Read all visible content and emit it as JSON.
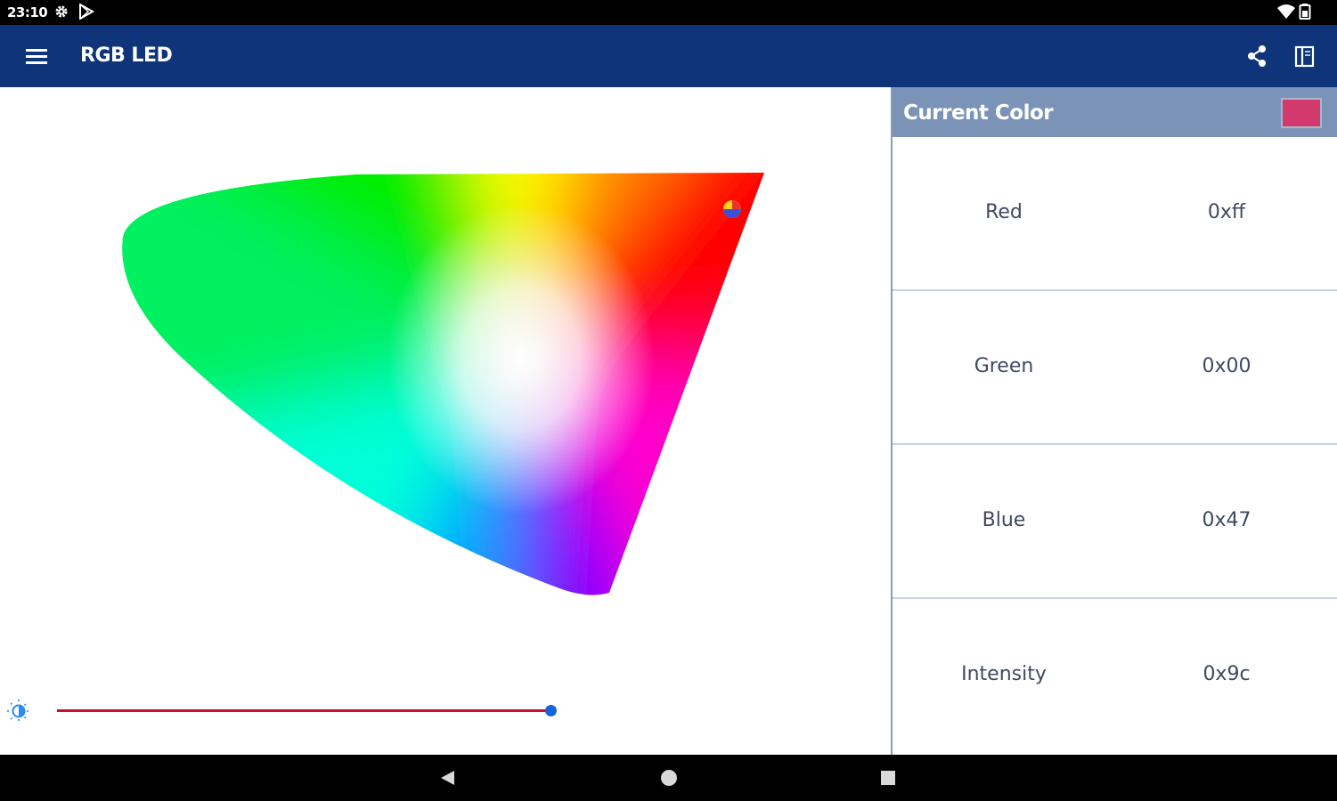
{
  "status_bar": {
    "time": "23:10",
    "icons": [
      "gear-icon",
      "play-store-icon",
      "wifi-icon",
      "battery-icon"
    ]
  },
  "app_bar": {
    "title": "RGB LED",
    "icons": [
      "menu-icon",
      "share-icon",
      "book-icon"
    ],
    "color": "#0f3479"
  },
  "current_color": {
    "title": "Current Color",
    "swatch_color": "#d23a6e",
    "rows": [
      {
        "label": "Red",
        "value": "0xff"
      },
      {
        "label": "Green",
        "value": "0x00"
      },
      {
        "label": "Blue",
        "value": "0x47"
      },
      {
        "label": "Intensity",
        "value": "0x9c"
      }
    ]
  },
  "brightness": {
    "level": 0.61,
    "icon": "brightness-icon"
  },
  "nav_bar": {
    "icons": [
      "back-icon",
      "home-icon",
      "recents-icon"
    ]
  }
}
